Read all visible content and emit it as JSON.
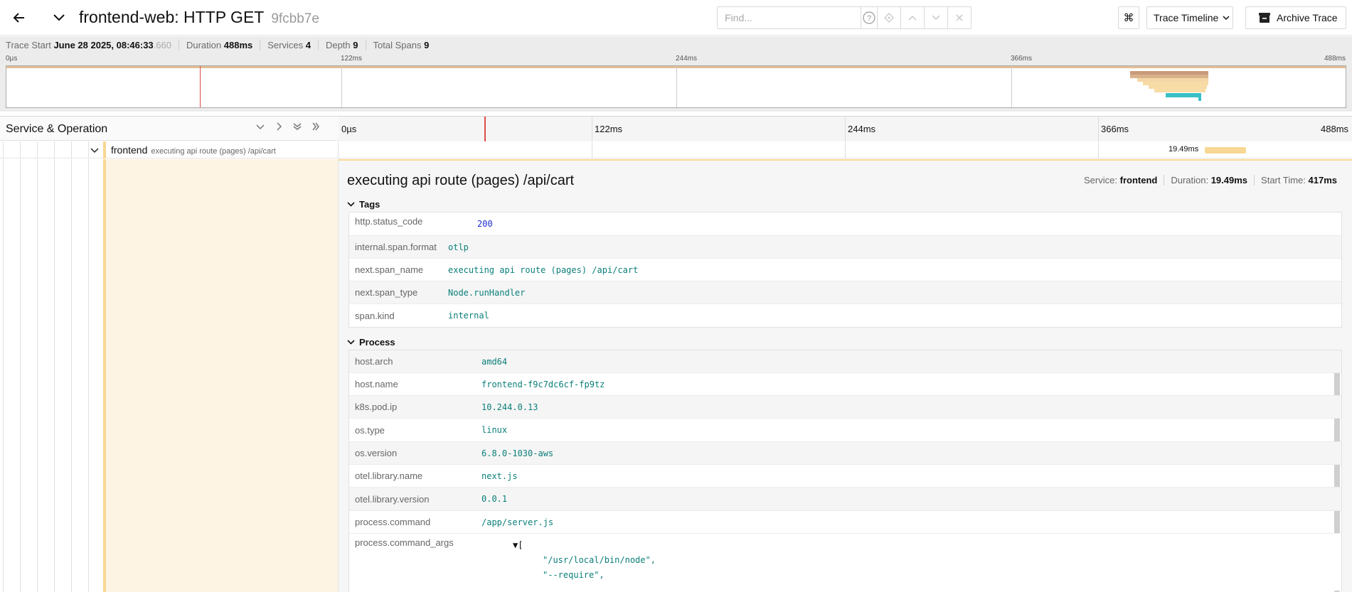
{
  "header": {
    "trace_name": "frontend-web: HTTP GET",
    "trace_id": "9fcbb7e",
    "find_placeholder": "Find...",
    "view_label": "Trace Timeline",
    "archive_label": "Archive Trace",
    "kbd_glyph": "⌘",
    "help_glyph": "?"
  },
  "summary": {
    "trace_start_label": "Trace Start",
    "trace_start_value": "June 28 2025, 08:46:33",
    "trace_start_ms": ".660",
    "duration_label": "Duration",
    "duration_value": "488ms",
    "services_label": "Services",
    "services_value": "4",
    "depth_label": "Depth",
    "depth_value": "9",
    "total_spans_label": "Total Spans",
    "total_spans_value": "9"
  },
  "minimap": {
    "ticks": [
      "0µs",
      "122ms",
      "244ms",
      "366ms",
      "488ms"
    ]
  },
  "timeline": {
    "so_title": "Service & Operation",
    "ticks": [
      "0µs",
      "122ms",
      "244ms",
      "366ms",
      "488ms"
    ]
  },
  "span_row": {
    "service": "frontend",
    "operation": "executing api route (pages) /api/cart",
    "duration_label": "19.49ms"
  },
  "detail": {
    "title": "executing api route (pages) /api/cart",
    "service_label": "Service:",
    "service_value": "frontend",
    "duration_label": "Duration:",
    "duration_value": "19.49ms",
    "start_label": "Start Time:",
    "start_value": "417ms",
    "tags_title": "Tags",
    "tags": [
      {
        "key": "http.status_code",
        "value": "200"
      },
      {
        "key": "internal.span.format",
        "value": "otlp"
      },
      {
        "key": "next.span_name",
        "value": "executing api route (pages) /api/cart"
      },
      {
        "key": "next.span_type",
        "value": "Node.runHandler"
      },
      {
        "key": "span.kind",
        "value": "internal"
      }
    ],
    "process_title": "Process",
    "process": [
      {
        "key": "host.arch",
        "value": "amd64"
      },
      {
        "key": "host.name",
        "value": "frontend-f9c7dc6cf-fp9tz"
      },
      {
        "key": "k8s.pod.ip",
        "value": "10.244.0.13"
      },
      {
        "key": "os.type",
        "value": "linux"
      },
      {
        "key": "os.version",
        "value": "6.8.0-1030-aws"
      },
      {
        "key": "otel.library.name",
        "value": "next.js"
      },
      {
        "key": "otel.library.version",
        "value": "0.0.1"
      },
      {
        "key": "process.command",
        "value": "/app/server.js"
      },
      {
        "key": "process.command_args",
        "value": ""
      }
    ],
    "command_args_open": "▼[",
    "command_args_items": [
      "\"/usr/local/bin/node\",",
      "\"--require\","
    ]
  },
  "colors": {
    "span_bar": "#f8d793",
    "span_bar_dark": "#d4a57e",
    "teal_bar": "#39c0c6",
    "time_marker": "#e04b4b",
    "json_string": "#0a7f7a",
    "json_number": "#1c2bd1"
  }
}
